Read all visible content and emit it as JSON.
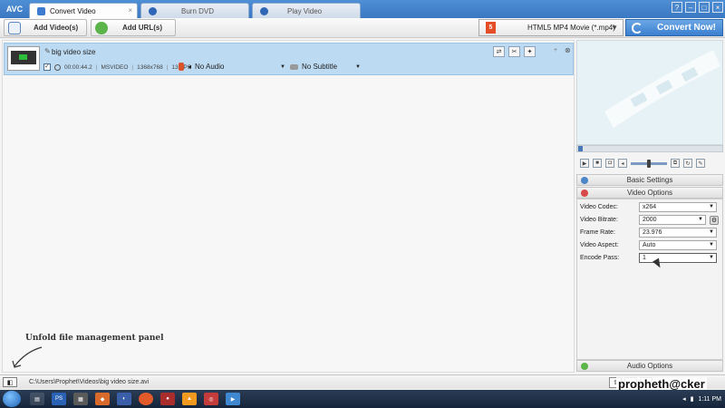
{
  "app": {
    "logo": "AVC"
  },
  "tabs": [
    {
      "label": "Convert Video",
      "active": true
    },
    {
      "label": "Burn DVD",
      "active": false
    },
    {
      "label": "Play Video",
      "active": false
    }
  ],
  "window_controls": {
    "help": "?",
    "minimize": "–",
    "maximize": "□",
    "close": "×"
  },
  "toolbar": {
    "add_videos": "Add Video(s)",
    "add_urls": "Add URL(s)",
    "profile": "HTML5 MP4 Movie (*.mp4)",
    "profile_badge": "5",
    "convert": "Convert Now!"
  },
  "file_item": {
    "name": "big video size",
    "duration": "00:00:44.2",
    "codec": "MSVIDEO",
    "resolution": "1368x768",
    "fps": "13 FPS",
    "audio": "No Audio",
    "subtitle": "No Subtitle"
  },
  "annotation": "Unfold file management panel",
  "panel": {
    "basic_settings": "Basic Settings",
    "video_options": "Video Options",
    "audio_options": "Audio Options",
    "rows": [
      {
        "label": "Video Codec:",
        "value": "x264"
      },
      {
        "label": "Video Bitrate:",
        "value": "2000"
      },
      {
        "label": "Frame Rate:",
        "value": "23.976"
      },
      {
        "label": "Video Aspect:",
        "value": "Auto"
      },
      {
        "label": "Encode Pass:",
        "value": "1"
      }
    ]
  },
  "statusbar": {
    "path": "C:\\Users\\Prophet\\Videos\\big video size.avi"
  },
  "watermark": "propheth@cker",
  "taskbar": {
    "time": "1:11 PM"
  },
  "colors": {
    "accent": "#3c7fcf",
    "selection": "#bcdaf2",
    "html5": "#e44d26"
  }
}
